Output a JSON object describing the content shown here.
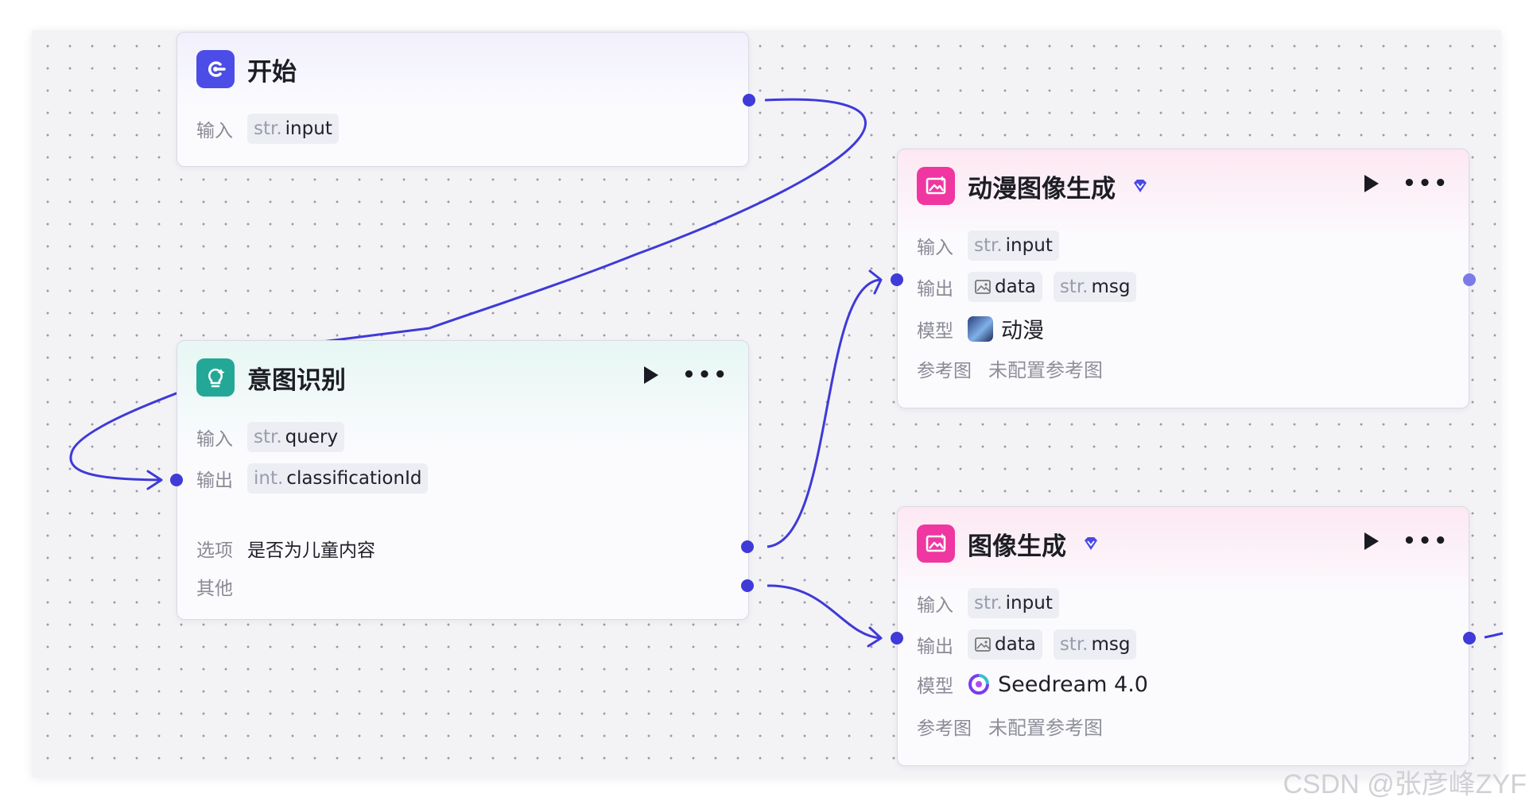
{
  "colors": {
    "accent": "#3f3ad8",
    "start_icon": "#4b4de6",
    "intent_icon": "#23a897",
    "image_icon": "#f036a0"
  },
  "nodes": {
    "start": {
      "title": "开始",
      "icon": "start-icon",
      "input_label": "输入",
      "input_type": "str.",
      "input_name": "input"
    },
    "intent": {
      "title": "意图识别",
      "icon": "lightbulb-icon",
      "input_label": "输入",
      "input_type": "str.",
      "input_name": "query",
      "output_label": "输出",
      "output_type": "int.",
      "output_name": "classificationId",
      "option_label": "选项",
      "option_value": "是否为儿童内容",
      "other_label": "其他"
    },
    "anime": {
      "title": "动漫图像生成",
      "icon": "image-generate-icon",
      "input_label": "输入",
      "input_type": "str.",
      "input_name": "input",
      "output_label": "输出",
      "output1_name": "data",
      "output2_type": "str.",
      "output2_name": "msg",
      "model_label": "模型",
      "model_value": "动漫",
      "ref_label": "参考图",
      "ref_value": "未配置参考图"
    },
    "image": {
      "title": "图像生成",
      "icon": "image-generate-icon",
      "input_label": "输入",
      "input_type": "str.",
      "input_name": "input",
      "output_label": "输出",
      "output1_name": "data",
      "output2_type": "str.",
      "output2_name": "msg",
      "model_label": "模型",
      "model_value": "Seedream 4.0",
      "ref_label": "参考图",
      "ref_value": "未配置参考图"
    }
  },
  "watermark": "CSDN @张彦峰ZYF"
}
